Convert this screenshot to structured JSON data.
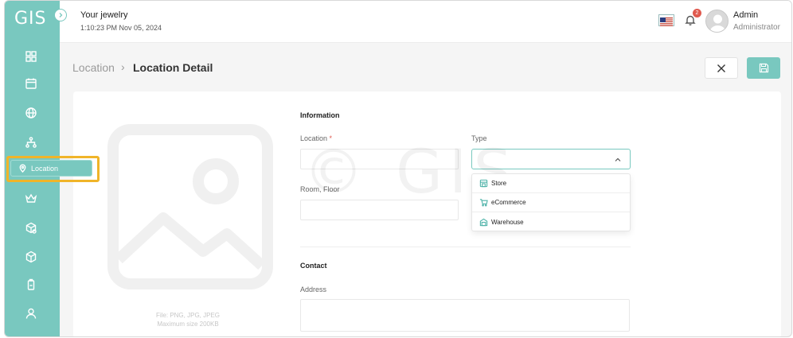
{
  "app": {
    "logo_text": "GIS",
    "store_name": "Your jewelry",
    "datetime": "1:10:23 PM Nov 05, 2024",
    "brand_color": "#79c8bf"
  },
  "header": {
    "notification_count": "2",
    "user_name": "Admin",
    "user_role": "Administrator"
  },
  "sidebar": {
    "items": [
      {
        "icon": "dashboard-icon"
      },
      {
        "icon": "calendar-icon"
      },
      {
        "icon": "globe-icon"
      },
      {
        "icon": "org-chart-icon"
      },
      {
        "icon": "location-pin-icon",
        "label": "Location",
        "active": true
      },
      {
        "icon": "crown-icon"
      },
      {
        "icon": "box-gear-icon"
      },
      {
        "icon": "cube-icon"
      },
      {
        "icon": "battery-icon"
      },
      {
        "icon": "user-icon"
      }
    ]
  },
  "breadcrumb": {
    "parent": "Location",
    "separator": "›",
    "current": "Location Detail"
  },
  "form": {
    "image": {
      "hint_line1": "File: PNG, JPG, JPEG",
      "hint_line2": "Maximum size 200KB"
    },
    "information_title": "Information",
    "location_label": "Location",
    "location_required": "*",
    "location_value": "",
    "type_label": "Type",
    "type_value": "",
    "type_options": [
      "Store",
      "eCommerce",
      "Warehouse"
    ],
    "room_label": "Room, Floor",
    "room_value": "",
    "contact_title": "Contact",
    "address_label": "Address",
    "address_value": ""
  },
  "watermark": "© GIS"
}
